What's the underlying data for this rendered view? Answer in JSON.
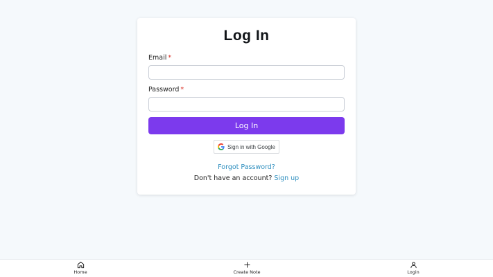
{
  "login": {
    "title": "Log In",
    "email_label": "Email",
    "email_value": "",
    "password_label": "Password",
    "password_value": "",
    "required_marker": "*",
    "submit_label": "Log In",
    "google_label": "Sign in with Google",
    "forgot_label": "Forgot Password?",
    "no_account_text": "Don't have an account?",
    "signup_label": "Sign up"
  },
  "nav": {
    "items": [
      {
        "label": "Home",
        "icon": "home-icon"
      },
      {
        "label": "Create Note",
        "icon": "plus-icon"
      },
      {
        "label": "Login",
        "icon": "person-icon"
      }
    ]
  },
  "colors": {
    "accent": "#7c3aed",
    "link": "#2f8fbf",
    "required": "#d93025",
    "background": "#f5f9fc"
  }
}
